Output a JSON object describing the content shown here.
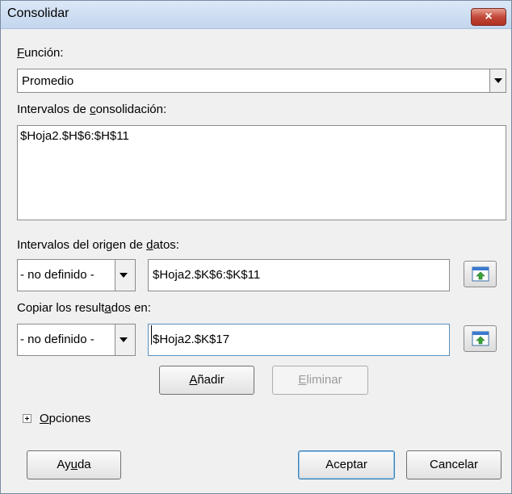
{
  "dialog": {
    "title": "Consolidar",
    "close_label": "×"
  },
  "function": {
    "label_access": "F",
    "label_rest": "unción:",
    "selected": "Promedio"
  },
  "ranges": {
    "label_pre": "Intervalos de ",
    "label_access": "c",
    "label_post": "onsolidación:",
    "items": [
      "$Hoja2.$H$6:$H$11"
    ]
  },
  "source": {
    "label_pre": "Intervalos del origen de ",
    "label_access": "d",
    "label_post": "atos:",
    "named_range": "- no definido -",
    "value": "$Hoja2.$K$6:$K$11"
  },
  "copy_to": {
    "label_pre": "Copiar los result",
    "label_access": "a",
    "label_post": "dos en:",
    "named_range": "- no definido -",
    "value": "$Hoja2.$K$17"
  },
  "buttons": {
    "add_access": "A",
    "add_rest": "ñadir",
    "delete_access": "E",
    "delete_rest": "liminar",
    "help_pre": "Ay",
    "help_access": "u",
    "help_post": "da",
    "ok": "Aceptar",
    "cancel": "Cancelar"
  },
  "options": {
    "label_access": "O",
    "label_rest": "pciones"
  }
}
